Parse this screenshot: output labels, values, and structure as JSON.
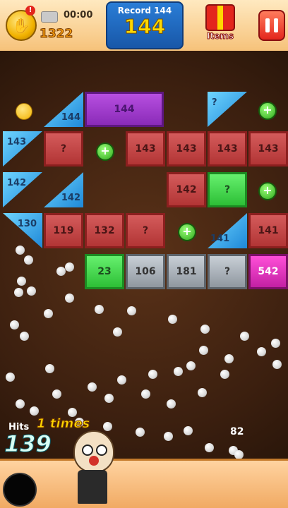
{
  "hud": {
    "coin_badge": "!",
    "coins": "1322",
    "timer": "00:00",
    "record_label": "Record 144",
    "record_value": "144",
    "items_label": "Items"
  },
  "board": {
    "bricks": [
      {
        "kind": "purple",
        "label": "144"
      },
      {
        "kind": "red",
        "label": "?"
      },
      {
        "kind": "red",
        "label": "143"
      },
      {
        "kind": "red",
        "label": "143"
      },
      {
        "kind": "red",
        "label": "143"
      },
      {
        "kind": "red",
        "label": "143"
      },
      {
        "kind": "red",
        "label": "142"
      },
      {
        "kind": "green",
        "label": "?"
      },
      {
        "kind": "red",
        "label": "119"
      },
      {
        "kind": "red",
        "label": "132"
      },
      {
        "kind": "red",
        "label": "?"
      },
      {
        "kind": "red",
        "label": "141"
      },
      {
        "kind": "green",
        "label": "23"
      },
      {
        "kind": "steel",
        "label": "106"
      },
      {
        "kind": "steel",
        "label": "181"
      },
      {
        "kind": "steel",
        "label": "?"
      },
      {
        "kind": "magenta",
        "label": "542"
      }
    ],
    "triangles": [
      "144",
      "?",
      "143",
      "142",
      "142",
      "130",
      "141"
    ]
  },
  "status": {
    "hits_label": "Hits",
    "times": "1 times",
    "hits_value": "139",
    "ball_count": "82"
  },
  "colors": {
    "hud_bg": "#f6c27a",
    "board_bg": "#3b1f0f",
    "brick_red": "#b23535",
    "brick_green": "#2dbf36",
    "brick_purple": "#8a2bb8",
    "brick_steel": "#8f979f",
    "brick_magenta": "#c320a3",
    "triangle_blue": "#1e88d8"
  }
}
